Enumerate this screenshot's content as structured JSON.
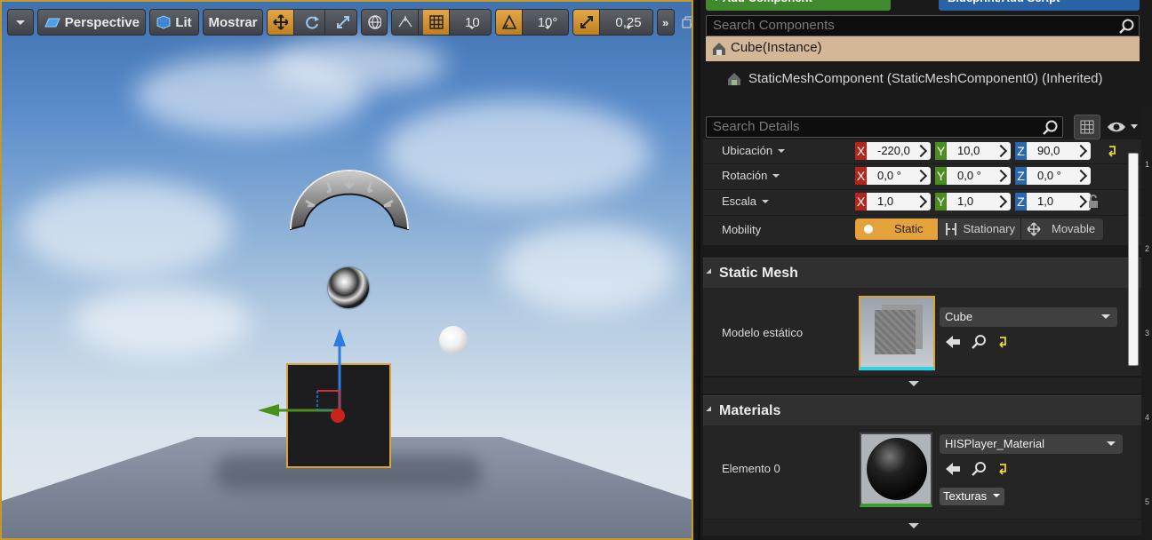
{
  "viewport": {
    "toolbar": {
      "perspective_label": "Perspective",
      "lit_label": "Lit",
      "show_label": "Mostrar",
      "grid_snap_value": "10",
      "rotation_snap_value": "10°",
      "scale_snap_value": "0,25"
    },
    "accent_color": "#d9a23a"
  },
  "components": {
    "top_buttons": [
      "+ Add Component",
      "Blueprint/Add Script"
    ],
    "search_placeholder": "Search Components",
    "instance_label": "Cube(Instance)",
    "child_label": "StaticMeshComponent (StaticMeshComponent0) (Inherited)"
  },
  "details": {
    "search_placeholder": "Search Details",
    "transform": {
      "location": {
        "label": "Ubicación",
        "x": "-220,0",
        "y": "10,0",
        "z": "90,0"
      },
      "rotation": {
        "label": "Rotación",
        "x": "0,0 °",
        "y": "0,0 °",
        "z": "0,0 °"
      },
      "scale": {
        "label": "Escala",
        "x": "1,0",
        "y": "1,0",
        "z": "1,0"
      }
    },
    "mobility": {
      "label": "Mobility",
      "options": [
        "Static",
        "Stationary",
        "Movable"
      ],
      "selected": "Static"
    },
    "static_mesh": {
      "section_title": "Static Mesh",
      "field_label": "Modelo estático",
      "value": "Cube"
    },
    "materials": {
      "section_title": "Materials",
      "element_label": "Elemento 0",
      "value": "HISPlayer_Material",
      "textures_label": "Texturas"
    }
  },
  "ruler_ticks": [
    "1",
    "2",
    "3",
    "4",
    "5"
  ]
}
